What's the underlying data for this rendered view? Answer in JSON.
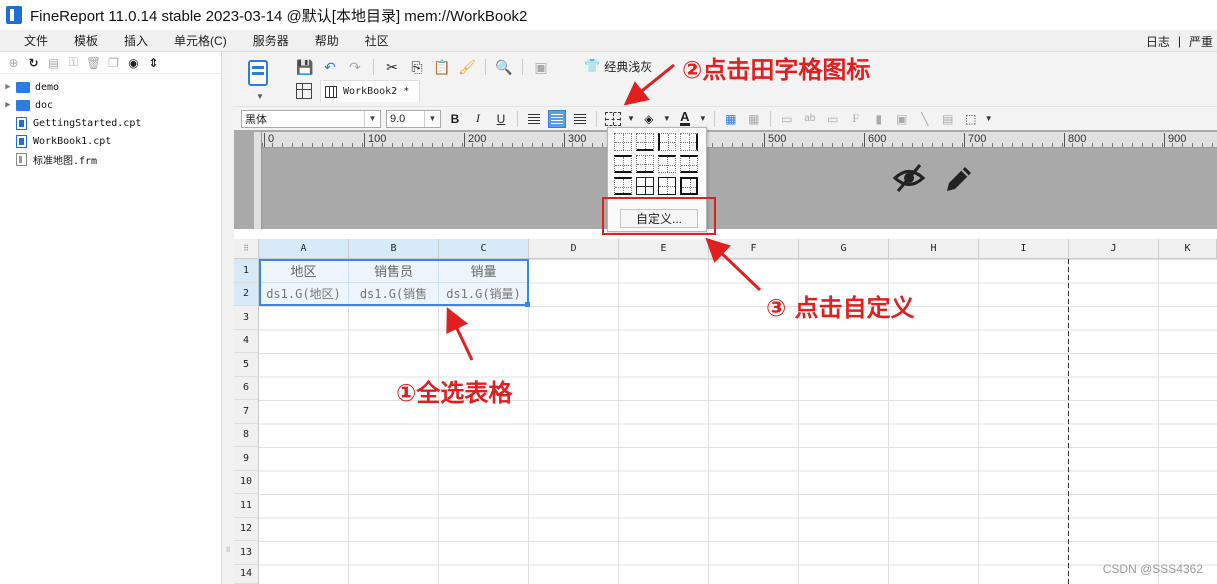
{
  "window": {
    "title": "FineReport 11.0.14 stable 2023-03-14 @默认[本地目录]    mem://WorkBook2"
  },
  "menu": {
    "items": [
      "文件",
      "模板",
      "插入",
      "单元格(C)",
      "服务器",
      "帮助",
      "社区"
    ],
    "right": [
      "日志",
      "|",
      "严重"
    ]
  },
  "tree": {
    "items": [
      {
        "label": "demo",
        "type": "folder"
      },
      {
        "label": "doc",
        "type": "folder"
      },
      {
        "label": "GettingStarted.cpt",
        "type": "cpt"
      },
      {
        "label": "WorkBook1.cpt",
        "type": "cpt"
      },
      {
        "label": "标准地图.frm",
        "type": "frm"
      }
    ]
  },
  "toolbar": {
    "theme_label": "经典浅灰",
    "tab_label": "WorkBook2 *"
  },
  "format": {
    "font_name": "黑体",
    "font_size": "9.0"
  },
  "ruler": {
    "labels": [
      "0",
      "100",
      "200",
      "300",
      "400",
      "500",
      "600",
      "700",
      "800",
      "900"
    ]
  },
  "sheet": {
    "columns": [
      "A",
      "B",
      "C",
      "D",
      "E",
      "F",
      "G",
      "H",
      "I",
      "J",
      "K"
    ],
    "rows": [
      "1",
      "2",
      "3",
      "4",
      "5",
      "6",
      "7",
      "8",
      "9",
      "10",
      "11",
      "12",
      "13",
      "14"
    ],
    "header_cells": [
      "地区",
      "销售员",
      "销量"
    ],
    "data_cells": [
      "ds1.G(地区)",
      "ds1.G(销售",
      "ds1.G(销量)"
    ]
  },
  "border_popup": {
    "custom_label": "自定义..."
  },
  "annotations": {
    "step1": "①全选表格",
    "step2": "②点击田字格图标",
    "step3": "③ 点击自定义",
    "color": "#e02020"
  },
  "watermark": "CSDN @SSS4362"
}
